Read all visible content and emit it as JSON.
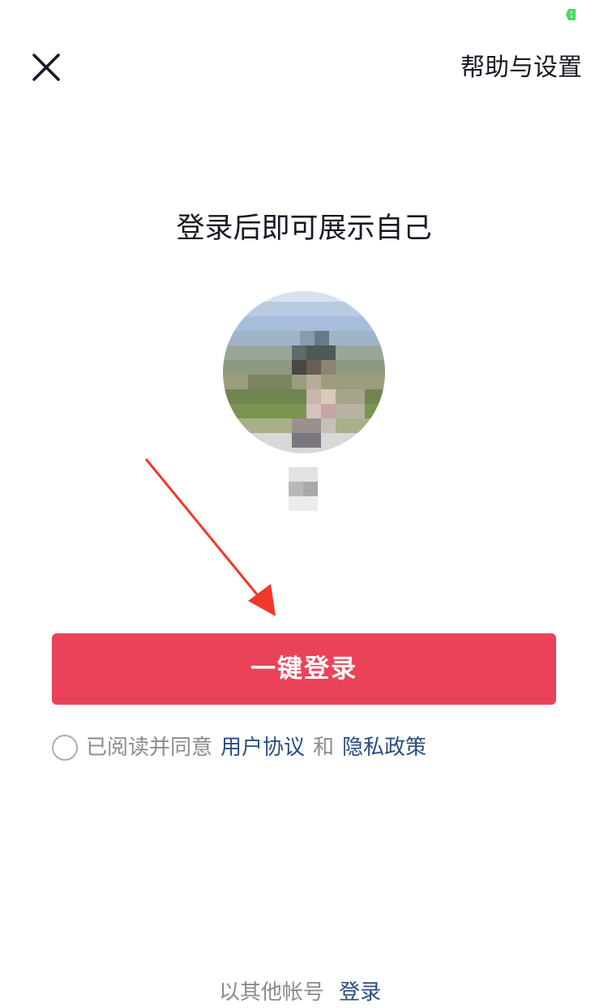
{
  "header": {
    "close_icon": "close-icon",
    "help_label": "帮助与设置"
  },
  "main": {
    "headline": "登录后即可展示自己",
    "avatar_icon": "avatar-pixelated",
    "login_button_label": "一键登录",
    "agreement": {
      "prefix": "已阅读并同意",
      "user_agreement": "用户协议",
      "conjunction": "和",
      "privacy_policy": "隐私政策"
    }
  },
  "footer": {
    "other_account_text": "以其他帐号",
    "login_link": "登录"
  },
  "colors": {
    "primary_button": "#ea4359",
    "link": "#2a4d82",
    "annotation_arrow": "#f0382b",
    "status_green": "#4cd964"
  }
}
